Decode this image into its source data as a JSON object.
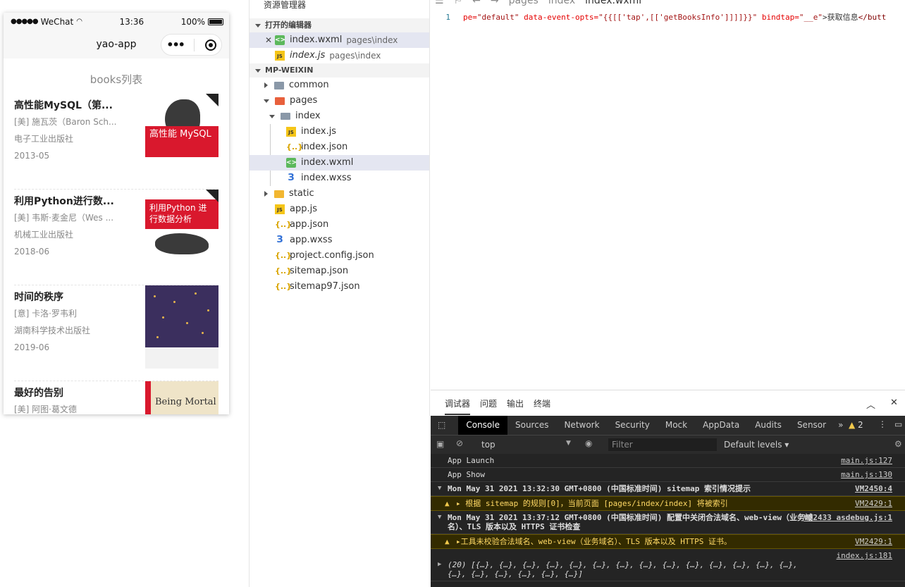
{
  "phone": {
    "status": {
      "carrier": "WeChat",
      "time": "13:36",
      "battery": "100%"
    },
    "nav_title": "yao-app",
    "heading": "books列表",
    "books": [
      {
        "title": "高性能MySQL（第...",
        "author": "[美] 施瓦茨（Baron Sch...",
        "publisher": "电子工业出版社",
        "date": "2013-05",
        "cover_title": "高性能 MySQL"
      },
      {
        "title": "利用Python进行数...",
        "author": "[美] 韦斯·麦金尼（Wes ...",
        "publisher": "机械工业出版社",
        "date": "2018-06",
        "cover_title": "利用Python 进行数据分析"
      },
      {
        "title": "时间的秩序",
        "author": "[意] 卡洛·罗韦利",
        "publisher": "湖南科学技术出版社",
        "date": "2019-06",
        "cover_title": ""
      },
      {
        "title": "最好的告别",
        "author": "[美] 阿图·葛文德",
        "publisher": "",
        "date": "",
        "cover_title": "Being Mortal"
      }
    ]
  },
  "explorer": {
    "title": "资源管理器",
    "open_editors_label": "打开的编辑器",
    "open_editors": [
      {
        "name": "index.wxml",
        "path": "pages\\index",
        "icon": "wxml-file-icon"
      },
      {
        "name": "index.js",
        "path": "pages\\index",
        "icon": "js-file-icon"
      }
    ],
    "project_label": "MP-WEIXIN",
    "tree": {
      "common": "common",
      "pages": "pages",
      "index": "index",
      "index_js": "index.js",
      "index_json": "index.json",
      "index_wxml": "index.wxml",
      "index_wxss": "index.wxss",
      "static": "static",
      "app_js": "app.js",
      "app_json": "app.json",
      "app_wxss": "app.wxss",
      "project_config": "project.config.json",
      "sitemap": "sitemap.json",
      "sitemap97": "sitemap97.json"
    }
  },
  "editor": {
    "breadcrumb": [
      "pages",
      "index",
      "index.wxml"
    ],
    "line_number": "1",
    "code_parts": [
      {
        "text": "pe=",
        "cls": "tok-attr"
      },
      {
        "text": "\"default\"",
        "cls": "tok-str"
      },
      {
        "text": " data-event-opts=",
        "cls": "tok-attr"
      },
      {
        "text": "\"{{[['tap',[['getBooksInfo']]]]}}\"",
        "cls": "tok-str"
      },
      {
        "text": " bindtap=",
        "cls": "tok-attr"
      },
      {
        "text": "\"__e\"",
        "cls": "tok-str"
      },
      {
        "text": ">获取信息",
        "cls": "tok-plain"
      },
      {
        "text": "</butt",
        "cls": "tok-tag"
      }
    ]
  },
  "devtools": {
    "panel_tabs": [
      "调试器",
      "问题",
      "输出",
      "终端"
    ],
    "tabs": [
      "Console",
      "Sources",
      "Network",
      "Security",
      "Mock",
      "AppData",
      "Audits",
      "Sensor"
    ],
    "more": "»",
    "warning_count": "2",
    "context": "top",
    "filter_placeholder": "Filter",
    "levels": "Default levels ▾",
    "logs": [
      {
        "text": "App Launch",
        "src": "main.js:127",
        "type": "log"
      },
      {
        "text": "App Show",
        "src": "main.js:130",
        "type": "log"
      },
      {
        "text": "Mon May 31 2021 13:32:30 GMT+0800 (中国标准时间) sitemap 索引情况提示",
        "src": "VM2450:4",
        "type": "group"
      },
      {
        "text": "▸ 根据 sitemap 的规则[0]，当前页面 [pages/index/index] 将被索引",
        "src": "VM2429:1",
        "type": "warn"
      },
      {
        "text": "Mon May 31 2021 13:37:12 GMT+0800 (中国标准时间) 配置中关闭合法域名、web-view（业务域名）、TLS 版本以及 HTTPS 证书检查",
        "src": "VM2433 asdebug.js:1",
        "type": "group"
      },
      {
        "text": "▸工具未校验合法域名、web-view（业务域名）、TLS 版本以及 HTTPS 证书。",
        "src": "VM2429:1",
        "type": "warn"
      },
      {
        "text": "(20) [{…}, {…}, {…}, {…}, {…}, {…}, {…}, {…}, {…}, {…}, {…}, {…}, {…}, {…}, {…}, {…}, {…}, {…}, {…}, {…}]",
        "src": "index.js:181",
        "type": "array"
      }
    ]
  }
}
